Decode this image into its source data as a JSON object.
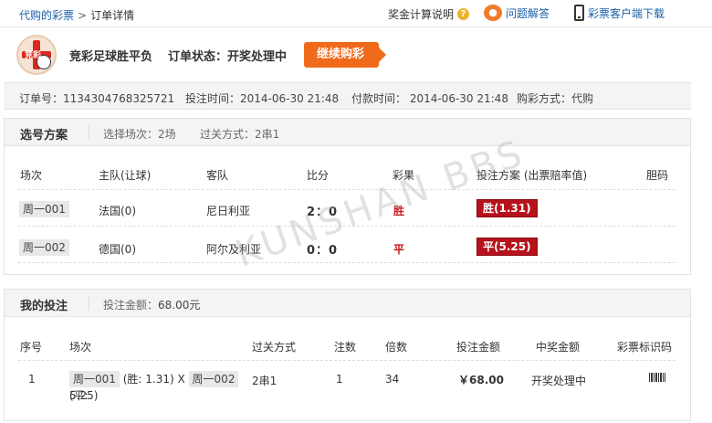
{
  "breadcrumb": {
    "parent": "代购的彩票",
    "separator": ">",
    "current": "订单详情"
  },
  "top_right": {
    "prize_rules": "奖金计算说明",
    "help_icon": "?",
    "faq": "问题解答",
    "client_download": "彩票客户端下载"
  },
  "header": {
    "logo_text": "竞彩",
    "lottery_name": "竞彩足球胜平负",
    "status_label": "订单状态：",
    "status_value": "开奖处理中",
    "continue_button": "继续购彩"
  },
  "order_info": {
    "order_no": "订单号：1134304768325721",
    "bet_time": "投注时间：2014-06-30 21:48",
    "pay_time": "付款时间：  2014-06-30 21:48",
    "buy_type": "购彩方式：代购"
  },
  "selection": {
    "title": "选号方案",
    "match_count": "选择场次：2场",
    "pass_type": "过关方式：2串1",
    "headers": [
      "场次",
      "主队(让球)",
      "客队",
      "比分",
      "彩果",
      "投注方案 (出票赔率值)",
      "胆码"
    ],
    "rows": [
      {
        "match": "周一001",
        "home": "法国(0)",
        "away": "尼日利亚",
        "score": "2：0",
        "result": "胜",
        "bet": "胜(1.31)",
        "banker": ""
      },
      {
        "match": "周一002",
        "home": "德国(0)",
        "away": "阿尔及利亚",
        "score": "0：0",
        "result": "平",
        "bet": "平(5.25)",
        "banker": ""
      }
    ]
  },
  "my_bet": {
    "title": "我的投注",
    "amount": "投注金额：",
    "amount_value": "68.00元",
    "headers": [
      "序号",
      "场次",
      "过关方式",
      "注数",
      "倍数",
      "投注金额",
      "中奖金额",
      "彩票标识码"
    ],
    "row": {
      "index": "1",
      "match1": "周一001",
      "match1_odds": "(胜: 1.31) X",
      "match2": "周一002",
      "match2_odds": "(平:",
      "match2_odds_cont": "5.25)",
      "pass_type": "2串1",
      "bets": "1",
      "multiple": "34",
      "amount": "￥68.00",
      "prize": "开奖处理中"
    }
  },
  "watermark": "KUNSHAN BBS"
}
